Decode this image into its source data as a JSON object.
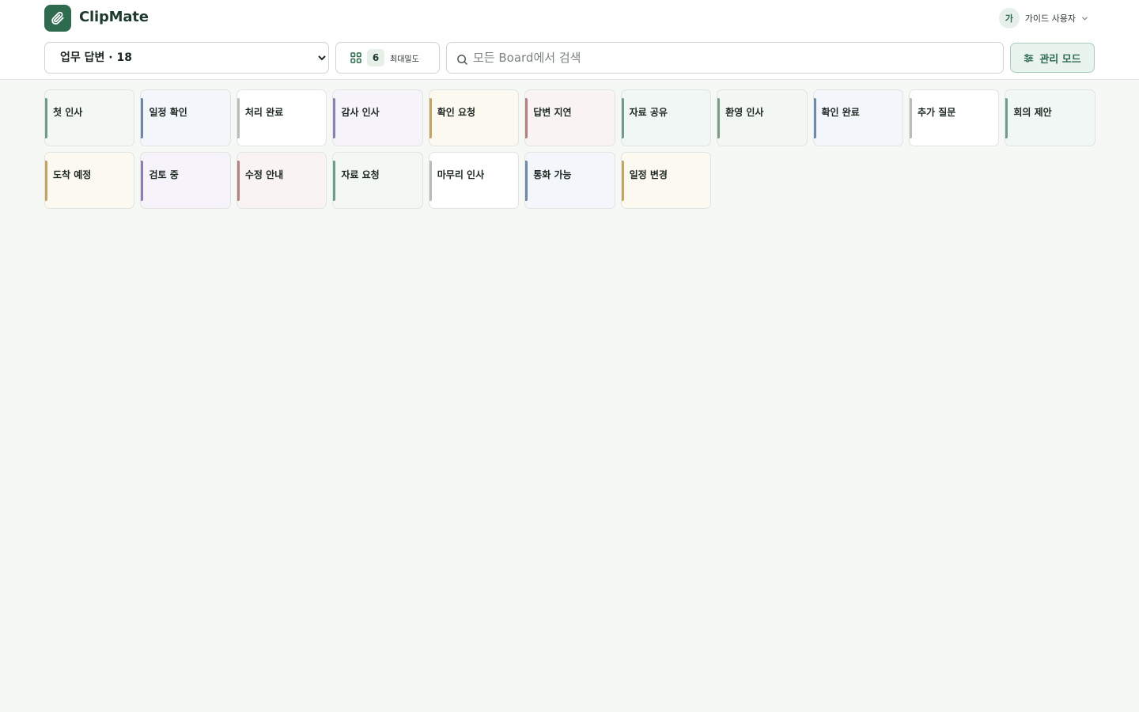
{
  "app": {
    "title": "ClipMate",
    "logo_icon": "paperclip-icon",
    "brand_color": "#2e6b4f"
  },
  "user": {
    "avatar_initial": "가",
    "name": "가이드 사용자"
  },
  "toolbar": {
    "board_selected": "업무 답변 · 18",
    "board_options": [
      "업무 답변 · 18"
    ],
    "density_count": "6",
    "density_label": "최대밀도",
    "search_placeholder": "모든 Board에서 검색",
    "search_value": "",
    "manage_label": "관리 모드"
  },
  "clips": [
    {
      "label": "첫 인사",
      "accent": "#6f9c84",
      "tint": "#f3f8f4"
    },
    {
      "label": "일정 확인",
      "accent": "#6f86a8",
      "tint": "#f3f6fb"
    },
    {
      "label": "처리 완료",
      "accent": "#b8bdba",
      "tint": "#ffffff"
    },
    {
      "label": "감사 인사",
      "accent": "#8d7fb3",
      "tint": "#f6f4fa"
    },
    {
      "label": "확인 요청",
      "accent": "#c4a463",
      "tint": "#fcf9f0"
    },
    {
      "label": "답변 지연",
      "accent": "#b47f7f",
      "tint": "#f9f4f3"
    },
    {
      "label": "자료 공유",
      "accent": "#6f9c8e",
      "tint": "#f1f7f4"
    },
    {
      "label": "환영 인사",
      "accent": "#7c9c86",
      "tint": "#f3f7f3"
    },
    {
      "label": "확인 완료",
      "accent": "#7088ac",
      "tint": "#f3f6fa"
    },
    {
      "label": "추가 질문",
      "accent": "#b8bdba",
      "tint": "#ffffff"
    },
    {
      "label": "회의 제안",
      "accent": "#6f9c8e",
      "tint": "#f1f7f4"
    },
    {
      "label": "도착 예정",
      "accent": "#c4a463",
      "tint": "#fcf9f0"
    },
    {
      "label": "검토 중",
      "accent": "#8d7fb3",
      "tint": "#f6f4fa"
    },
    {
      "label": "수정 안내",
      "accent": "#b47f7f",
      "tint": "#f9f4f3"
    },
    {
      "label": "자료 요청",
      "accent": "#6f9c84",
      "tint": "#f3f8f4"
    },
    {
      "label": "마무리 인사",
      "accent": "#b8bdba",
      "tint": "#ffffff"
    },
    {
      "label": "통화 가능",
      "accent": "#6f86a8",
      "tint": "#f3f6fb"
    },
    {
      "label": "일정 변경",
      "accent": "#c4a463",
      "tint": "#fcf9f0"
    }
  ]
}
